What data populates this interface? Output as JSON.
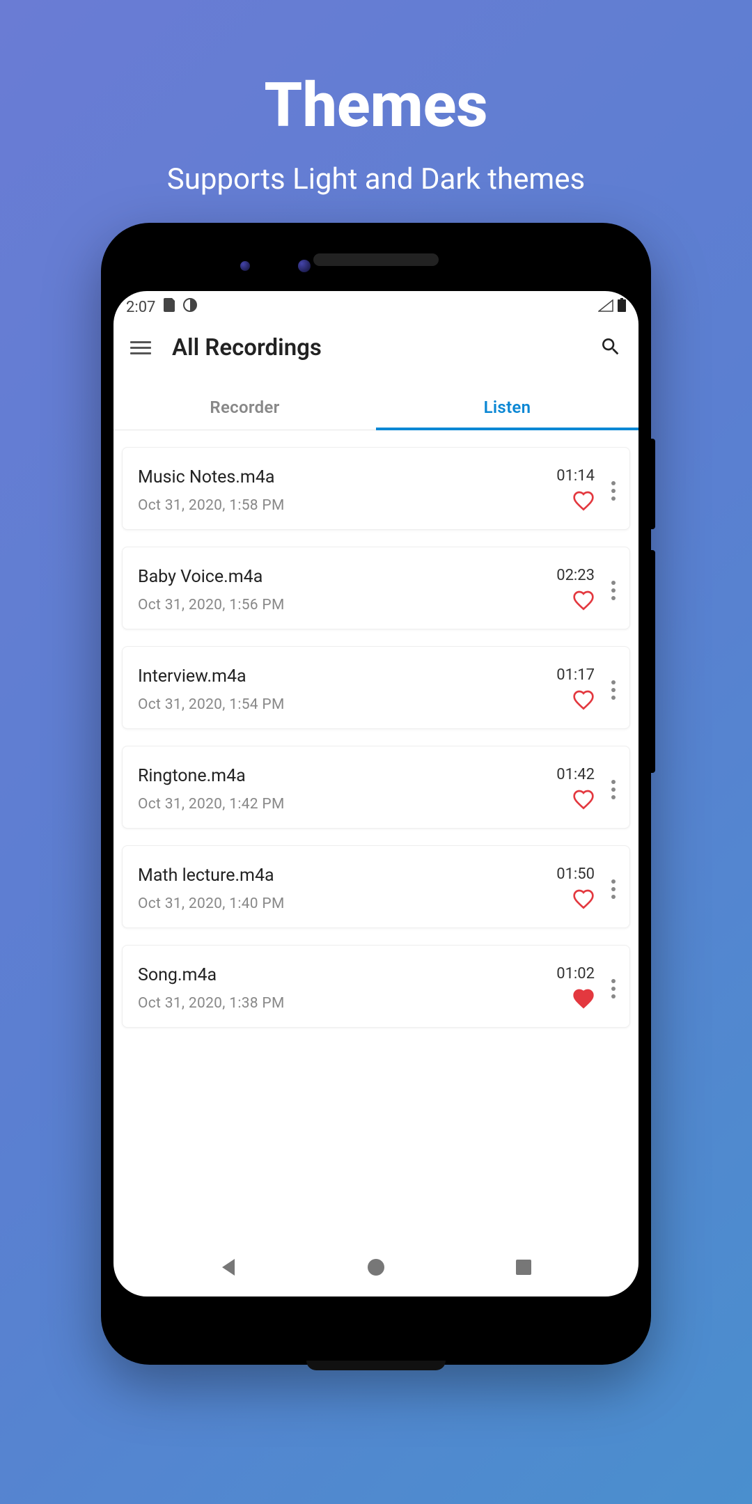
{
  "hero": {
    "title": "Themes",
    "subtitle": "Supports Light and Dark themes"
  },
  "status": {
    "time": "2:07"
  },
  "appbar": {
    "title": "All Recordings"
  },
  "tabs": {
    "recorder": "Recorder",
    "listen": "Listen",
    "active": "listen"
  },
  "recordings": [
    {
      "title": "Music Notes.m4a",
      "date": "Oct 31, 2020, 1:58 PM",
      "duration": "01:14",
      "favorite": false
    },
    {
      "title": "Baby Voice.m4a",
      "date": "Oct 31, 2020, 1:56 PM",
      "duration": "02:23",
      "favorite": false
    },
    {
      "title": "Interview.m4a",
      "date": "Oct 31, 2020, 1:54 PM",
      "duration": "01:17",
      "favorite": false
    },
    {
      "title": "Ringtone.m4a",
      "date": "Oct 31, 2020, 1:42 PM",
      "duration": "01:42",
      "favorite": false
    },
    {
      "title": "Math lecture.m4a",
      "date": "Oct 31, 2020, 1:40 PM",
      "duration": "01:50",
      "favorite": false
    },
    {
      "title": "Song.m4a",
      "date": "Oct 31, 2020, 1:38 PM",
      "duration": "01:02",
      "favorite": true
    }
  ],
  "colors": {
    "accent": "#0b87d4",
    "heart": "#e3383f"
  }
}
